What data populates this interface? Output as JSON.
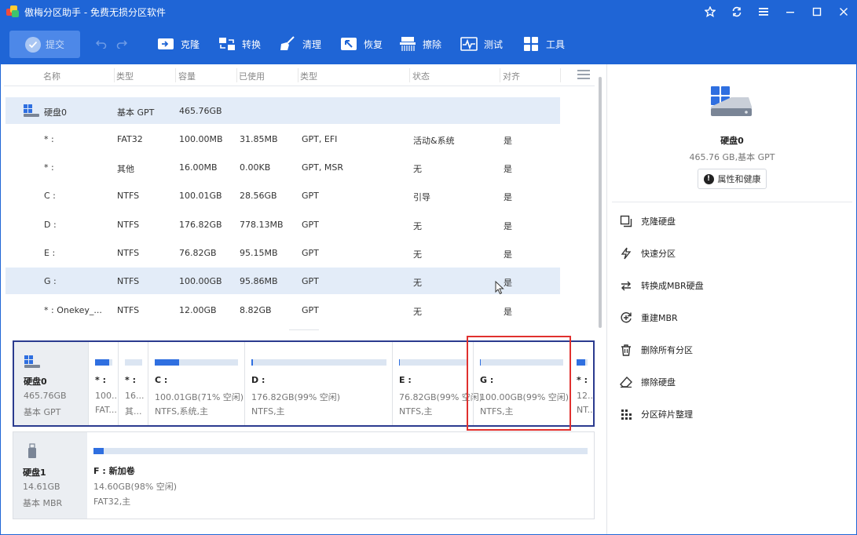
{
  "window": {
    "title": "傲梅分区助手 - 免费无损分区软件"
  },
  "toolbar": {
    "submit_label": "提交",
    "tools": [
      {
        "label": "克隆",
        "icon": "clone-icon"
      },
      {
        "label": "转换",
        "icon": "convert-icon"
      },
      {
        "label": "清理",
        "icon": "broom-icon"
      },
      {
        "label": "恢复",
        "icon": "restore-icon"
      },
      {
        "label": "擦除",
        "icon": "shredder-icon"
      },
      {
        "label": "测试",
        "icon": "pulse-icon"
      },
      {
        "label": "工具",
        "icon": "grid-tools-icon"
      }
    ]
  },
  "table": {
    "headers": [
      "名称",
      "类型",
      "容量",
      "已使用",
      "类型",
      "状态",
      "对齐"
    ],
    "disk_row": {
      "name": "硬盘0",
      "type": "基本 GPT",
      "capacity": "465.76GB"
    },
    "rows": [
      {
        "name": "* :",
        "fs": "FAT32",
        "capacity": "100.00MB",
        "used": "31.85MB",
        "type": "GPT, EFI",
        "status": "活动&系统",
        "align": "是"
      },
      {
        "name": "* :",
        "fs": "其他",
        "capacity": "16.00MB",
        "used": "0.00KB",
        "type": "GPT, MSR",
        "status": "无",
        "align": "是"
      },
      {
        "name": "C :",
        "fs": "NTFS",
        "capacity": "100.01GB",
        "used": "28.56GB",
        "type": "GPT",
        "status": "引导",
        "align": "是"
      },
      {
        "name": "D :",
        "fs": "NTFS",
        "capacity": "176.82GB",
        "used": "778.13MB",
        "type": "GPT",
        "status": "无",
        "align": "是"
      },
      {
        "name": "E :",
        "fs": "NTFS",
        "capacity": "76.82GB",
        "used": "95.15MB",
        "type": "GPT",
        "status": "无",
        "align": "是"
      },
      {
        "name": "G :",
        "fs": "NTFS",
        "capacity": "100.00GB",
        "used": "95.86MB",
        "type": "GPT",
        "status": "无",
        "align": "是"
      },
      {
        "name": "* : Onekey_...",
        "fs": "NTFS",
        "capacity": "12.00GB",
        "used": "8.82GB",
        "type": "GPT",
        "status": "无",
        "align": "是"
      }
    ]
  },
  "diskmap": {
    "disk0": {
      "name": "硬盘0",
      "size": "465.76GB",
      "type": "基本 GPT",
      "parts": [
        {
          "label": "* :",
          "size": "100...",
          "fs": "FAT...",
          "fill": 0.8
        },
        {
          "label": "* :",
          "size": "16...",
          "fs": "其...",
          "fill": 0.0
        },
        {
          "label": "C :",
          "size": "100.01GB(71% 空闲)",
          "fs": "NTFS,系统,主",
          "fill": 0.29
        },
        {
          "label": "D :",
          "size": "176.82GB(99% 空闲)",
          "fs": "NTFS,主",
          "fill": 0.01
        },
        {
          "label": "E :",
          "size": "76.82GB(99% 空闲)",
          "fs": "NTFS,主",
          "fill": 0.01
        },
        {
          "label": "G :",
          "size": "100.00GB(99% 空闲)",
          "fs": "NTFS,主",
          "fill": 0.01
        },
        {
          "label": "* :",
          "size": "12...",
          "fs": "NT...",
          "fill": 0.75
        }
      ]
    },
    "disk1": {
      "name": "硬盘1",
      "size": "14.61GB",
      "type": "基本 MBR",
      "parts": [
        {
          "label": "F : 新加卷",
          "size": "14.60GB(98% 空闲)",
          "fs": "FAT32,主",
          "fill": 0.02
        }
      ]
    }
  },
  "right_panel": {
    "disk_name": "硬盘0",
    "disk_sub": "465.76 GB,基本 GPT",
    "properties_label": "属性和健康",
    "operations": [
      {
        "label": "克隆硬盘",
        "icon": "clone-disk-icon"
      },
      {
        "label": "快速分区",
        "icon": "lightning-icon"
      },
      {
        "label": "转换成MBR硬盘",
        "icon": "convert-arrows-icon"
      },
      {
        "label": "重建MBR",
        "icon": "rebuild-icon"
      },
      {
        "label": "删除所有分区",
        "icon": "trash-icon"
      },
      {
        "label": "擦除硬盘",
        "icon": "eraser-icon"
      },
      {
        "label": "分区碎片整理",
        "icon": "defrag-icon"
      }
    ]
  },
  "colors": {
    "brand": "#1f65d6",
    "used_bar": "#2f6fe0",
    "highlight": "#e0302e"
  }
}
